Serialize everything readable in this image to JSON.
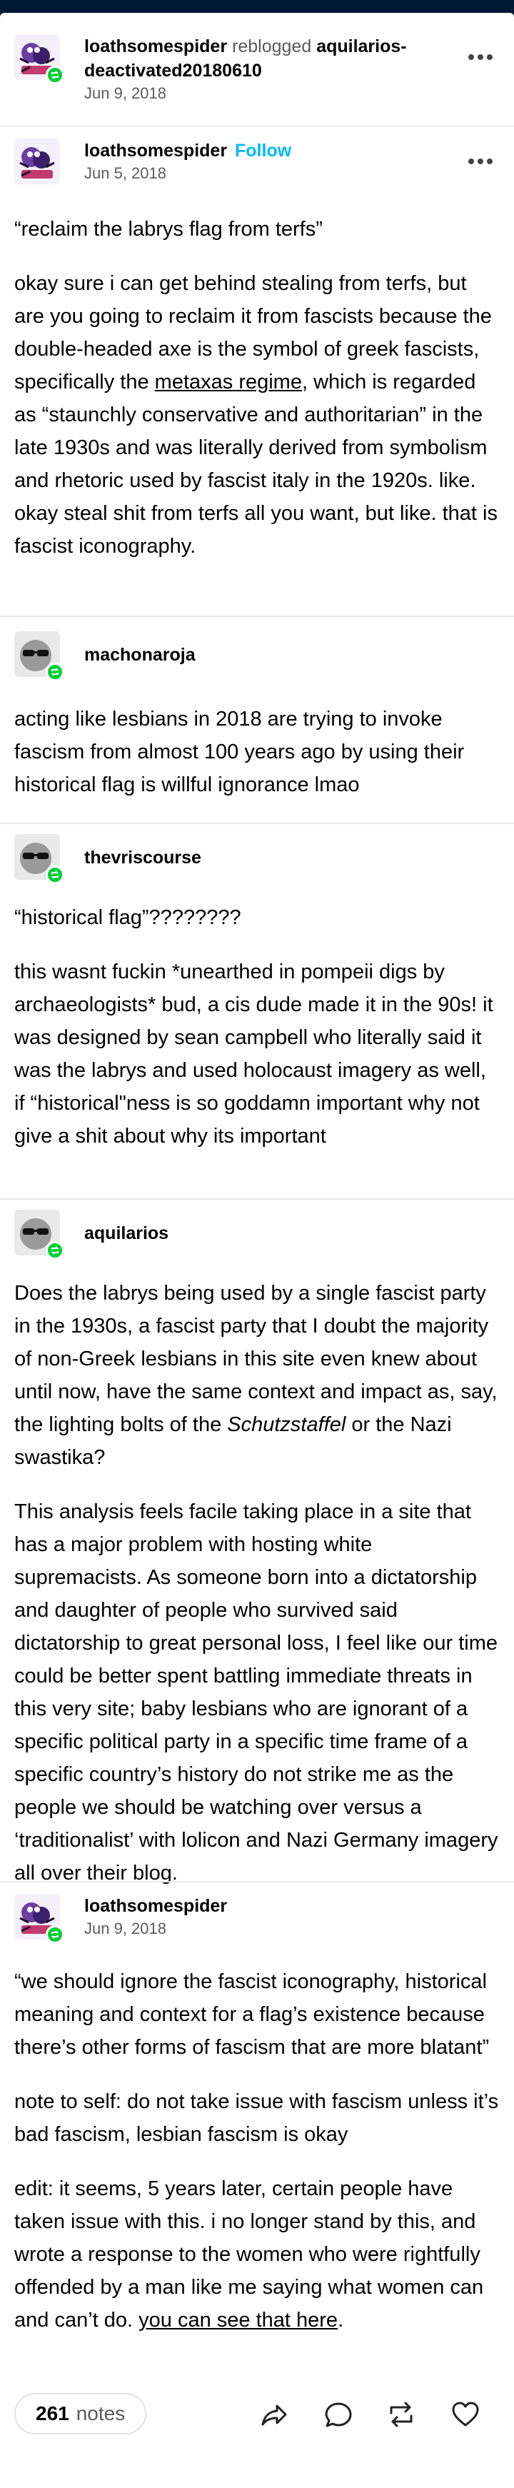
{
  "header": {
    "username": "loathsomespider",
    "reblogged_text": "reblogged",
    "source_user": "aquilarios-deactivated20180610",
    "date": "Jun 9, 2018"
  },
  "post": {
    "username": "loathsomespider",
    "follow_label": "Follow",
    "date": "Jun 5, 2018",
    "quote": "“reclaim the labrys flag from terfs”",
    "body_1": "okay sure i can get behind stealing from terfs, but are you going to reclaim it from fascists because the double-headed axe is the symbol of greek fascists, specifically the ",
    "body_link": "metaxas regime",
    "body_2": ", which is regarded as “staunchly conservative and authoritarian” in the late 1930s and was literally derived from symbolism and rhetoric used by fascist italy in the 1920s. like. okay steal shit from terfs all you want, but like. that is fascist iconography."
  },
  "reblogs": [
    {
      "username": "machonaroja",
      "paragraphs": [
        "acting like lesbians in 2018 are trying to invoke fascism from almost 100 years ago by using their historical flag is willful ignorance lmao"
      ]
    },
    {
      "username": "thevriscourse",
      "paragraphs": [
        "“historical flag”????????",
        "this wasnt fuckin *unearthed in pompeii digs by archaeologists* bud, a cis dude made it in the 90s! it was designed by sean campbell who literally said it was the labrys and used holocaust imagery as well, if “historical\"ness is so goddamn important why not give a shit about why its important"
      ]
    },
    {
      "username": "aquilarios",
      "p1_a": "Does the labrys being used by a single fascist party in the 1930s, a fascist party that I doubt the majority of non-Greek lesbians in this site even knew about until now, have the same context and impact as, say, the lighting bolts of the ",
      "p1_italic": "Schutzstaffel",
      "p1_b": " or the Nazi swastika?",
      "p2": "This analysis feels facile taking place in a site that has a major problem with hosting white supremacists. As someone born into a dictatorship and daughter of people who survived said dictatorship to great personal loss, I feel like our time could be better spent battling immediate threats in this very site; baby lesbians who are ignorant of a specific political party in a specific time frame of a specific country’s history do not strike me as the people we should be watching over versus a ‘traditionalist’ with lolicon and Nazi Germany imagery all over their blog."
    },
    {
      "username": "loathsomespider",
      "date": "Jun 9, 2018",
      "p1": "“we should ignore the fascist iconography, historical meaning and context for a flag’s existence because there’s other forms of fascism that are more blatant”",
      "p2": "note to self: do not take issue with fascism unless it’s bad fascism, lesbian fascism is okay",
      "p3_a": "edit: it seems, 5 years later, certain people have taken issue with this. i no longer stand by this, and wrote a response to the women who were rightfully offended by a man like me saying what women can and can’t do. ",
      "p3_link": "you can see that here",
      "p3_b": "."
    }
  ],
  "footer": {
    "notes_count": "261",
    "notes_label": "notes"
  },
  "icons": {
    "more": "more-dots-icon",
    "share": "share-icon",
    "reply": "reply-icon",
    "reblog": "reblog-icon",
    "like": "heart-icon"
  },
  "colors": {
    "background": "#001935",
    "follow": "#00b8ff",
    "reblog_badge": "#00cf35"
  }
}
